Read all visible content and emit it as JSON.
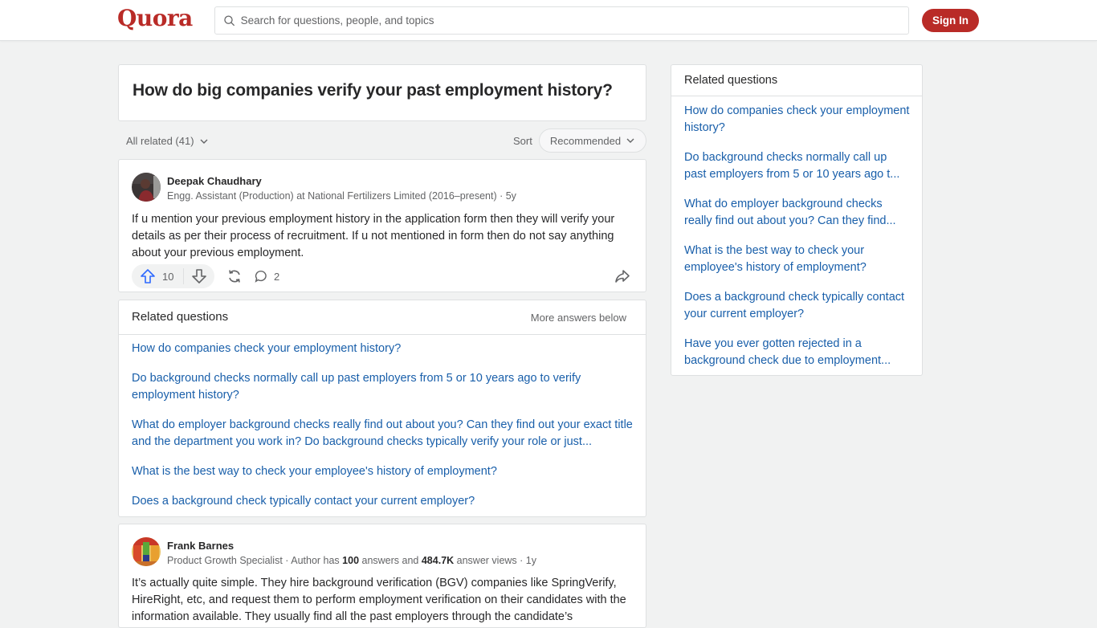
{
  "header": {
    "logo": "Quora",
    "search_placeholder": "Search for questions, people, and topics",
    "signin_label": "Sign In",
    "brand_color": "#b92b27"
  },
  "question": {
    "title": "How do big companies verify your past employment history?"
  },
  "filters": {
    "all_related_label": "All related (41)",
    "sort_label": "Sort",
    "sort_value": "Recommended"
  },
  "answers": [
    {
      "author": "Deepak Chaudhary",
      "credential": "Engg. Assistant (Production) at National Fertilizers Limited (2016–present) · 5y",
      "body": "If u mention your previous employment history in the application form then they will verify your details as per their process of recruitment. If u not mentioned in form then do not say anything about your previous employment.",
      "upvotes": "10",
      "comments": "2"
    },
    {
      "author": "Frank Barnes",
      "credential_prefix": "Product Growth Specialist · Author has ",
      "answers_count": "100",
      "credential_mid": " answers and ",
      "views_count": "484.7K",
      "credential_suffix": " answer views · 1y",
      "body": "It’s actually quite simple. They hire background verification (BGV) companies like SpringVerify, HireRight, etc, and request them to perform employment verification on their candidates with the information available. They usually find all the past employers through the candidate’s"
    }
  ],
  "related_inline": {
    "title": "Related questions",
    "more_label": "More answers below",
    "items": [
      "How do companies check your employment history?",
      "Do background checks normally call up past employers from 5 or 10 years ago to verify employment history?",
      "What do employer background checks really find out about you? Can they find out your exact title and the department you work in? Do background checks typically verify your role or just...",
      "What is the best way to check your employee's history of employment?",
      "Does a background check typically contact your current employer?"
    ]
  },
  "sidebar": {
    "title": "Related questions",
    "items": [
      "How do companies check your employment history?",
      "Do background checks normally call up past employers from 5 or 10 years ago t...",
      "What do employer background checks really find out about you? Can they find...",
      "What is the best way to check your employee's history of employment?",
      "Does a background check typically contact your current employer?",
      "Have you ever gotten rejected in a background check due to employment..."
    ]
  }
}
